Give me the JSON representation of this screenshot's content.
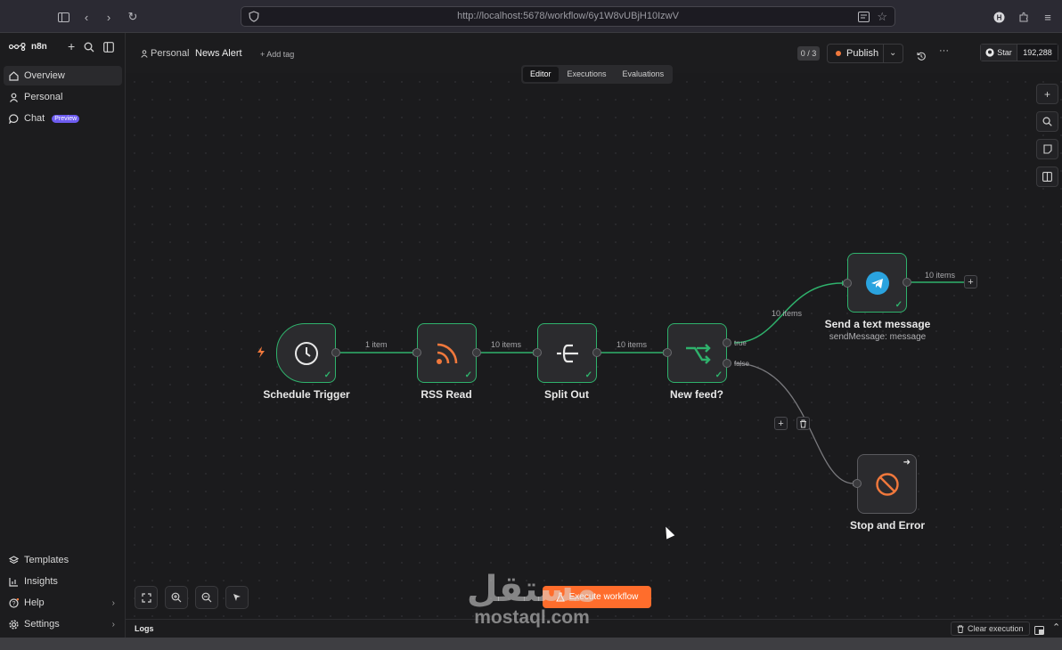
{
  "browser": {
    "url": "http://localhost:5678/workflow/6y1W8vUBjH10IzwV"
  },
  "sidebar": {
    "brand": "n8n",
    "items": [
      {
        "label": "Overview"
      },
      {
        "label": "Personal"
      },
      {
        "label": "Chat",
        "badge": "Preview"
      }
    ],
    "bottom_items": [
      {
        "label": "Templates"
      },
      {
        "label": "Insights"
      },
      {
        "label": "Help"
      },
      {
        "label": "Settings"
      }
    ]
  },
  "header": {
    "project": "Personal",
    "workflow_name": "News Alert",
    "add_tag": "+ Add tag",
    "counter": "0 / 3",
    "publish_label": "Publish",
    "star_label": "Star",
    "star_count": "192,288"
  },
  "tabs": [
    {
      "label": "Editor",
      "active": true
    },
    {
      "label": "Executions",
      "active": false
    },
    {
      "label": "Evaluations",
      "active": false
    }
  ],
  "workflow": {
    "nodes": [
      {
        "id": "schedule",
        "label": "Schedule Trigger",
        "icon": "clock-icon"
      },
      {
        "id": "rss",
        "label": "RSS Read",
        "icon": "rss-icon"
      },
      {
        "id": "split",
        "label": "Split Out",
        "icon": "split-icon"
      },
      {
        "id": "ifnode",
        "label": "New feed?",
        "icon": "branch-icon"
      },
      {
        "id": "telegram",
        "label": "Send a text message",
        "subtitle": "sendMessage: message",
        "icon": "telegram-icon"
      },
      {
        "id": "stop",
        "label": "Stop and Error",
        "icon": "stop-icon"
      }
    ],
    "edges": {
      "schedule_rss": "1 item",
      "rss_split": "10 items",
      "split_if": "10 items",
      "if_true": "10 items",
      "telegram_out": "10 items"
    },
    "branch_labels": {
      "true": "true",
      "false": "false"
    }
  },
  "canvas_controls": {
    "execute_label": "Execute workflow"
  },
  "logs": {
    "label": "Logs",
    "clear_label": "Clear execution"
  },
  "watermark": {
    "arabic": "مستقل",
    "latin": "mostaql.com"
  },
  "colors": {
    "success": "#2fb26c",
    "accent": "#ff6d2c",
    "rss": "#f0783c",
    "telegram": "#2aa3df"
  }
}
